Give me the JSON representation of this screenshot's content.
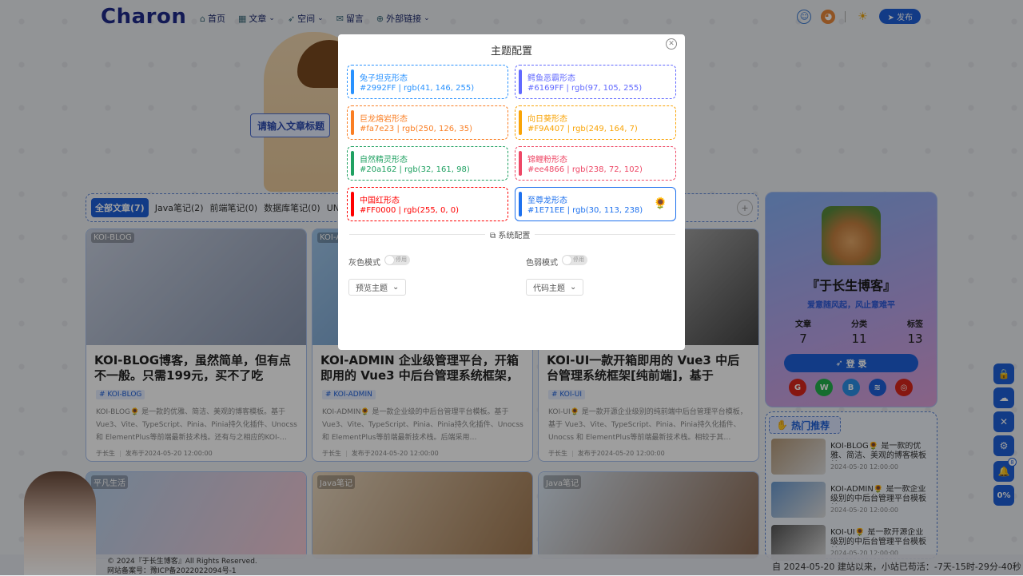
{
  "header": {
    "logo": "Charon",
    "nav": [
      {
        "icon": "home-icon",
        "glyph": "⌂",
        "label": "首页",
        "chevron": false
      },
      {
        "icon": "grid-icon",
        "glyph": "▦",
        "label": "文章",
        "chevron": true
      },
      {
        "icon": "rocket-icon",
        "glyph": "➶",
        "label": "空间",
        "chevron": true
      },
      {
        "icon": "message-icon",
        "glyph": "✉",
        "label": "留言",
        "chevron": false
      },
      {
        "icon": "link-icon",
        "glyph": "⊕",
        "label": "外部链接",
        "chevron": true
      }
    ],
    "publish": "发布"
  },
  "hero": {
    "search_label": "请输入文章标题"
  },
  "tabs": {
    "items": [
      "全部文章(7)",
      "Java笔记(2)",
      "前端笔记(0)",
      "数据库笔记(0)",
      "UN"
    ],
    "plus": "+"
  },
  "cards": [
    {
      "badge": "KOI-BLOG",
      "title": "KOI-BLOG博客，虽然简单，但有点不一般。只需199元，买不了吃亏，…",
      "tag": "# KOI-BLOG",
      "desc": "KOI-BLOG🌻 是一款的优雅、简洁、美观的博客模板。基于 Vue3、Vite、TypeScript、Pinia、Pinia持久化插件、Unocss 和 ElementPlus等前端最新技术栈。还有与之相应的KOI-…",
      "author": "于长生",
      "date": "发布于2024-05-20 12:00:00",
      "color1": "#c8d0e0",
      "color2": "#8a97b0"
    },
    {
      "badge": "KOI-ADMIN",
      "title": "KOI-ADMIN 企业级管理平台，开箱即用的 Vue3 中后台管理系统框架，从…",
      "tag": "# KOI-ADMIN",
      "desc": "KOI-ADMIN🌻 是一款企业级的中后台管理平台模板。基于 Vue3、Vite、TypeScript、Pinia、Pinia持久化插件、Unocss 和 ElementPlus等前端最新技术栈。后端采用…",
      "author": "于长生",
      "date": "发布于2024-05-20 12:00:00",
      "color1": "#9fc6ea",
      "color2": "#5a86b8"
    },
    {
      "badge": "KOI-UI",
      "title": "KOI-UI一款开箱即用的 Vue3 中后台管理系统框架[纯前端]，基于 Vue3…",
      "tag": "# KOI-UI",
      "desc": "KOI-UI🌻 是一款开源企业级别的纯前端中后台管理平台模板，基于 Vue3、Vite、TypeScript、Pinia、Pinia持久化插件、Unocss 和 ElementPlus等前端最新技术栈。相较于其…",
      "author": "于长生",
      "date": "发布于2024-05-20 12:00:00",
      "color1": "#e6e6e6",
      "color2": "#444444"
    }
  ],
  "cards_bottom": [
    {
      "badge": "平凡生活",
      "color1": "#b7d2ec",
      "color2": "#f4c7d3"
    },
    {
      "badge": "Java笔记",
      "color1": "#e8d7bf",
      "color2": "#a07850"
    },
    {
      "badge": "Java笔记",
      "color1": "#dbe8f5",
      "color2": "#8a6850"
    }
  ],
  "profile": {
    "name": "『于长生博客』",
    "slogan": "爱意随风起，风止意难平",
    "stats": [
      {
        "label": "文章",
        "value": "7"
      },
      {
        "label": "分类",
        "value": "11"
      },
      {
        "label": "标签",
        "value": "13"
      }
    ],
    "login": "登 录",
    "socials": [
      {
        "name": "gitee-icon",
        "glyph": "G",
        "color": "#d9261c"
      },
      {
        "name": "wechat-icon",
        "glyph": "W",
        "color": "#22b14c"
      },
      {
        "name": "bilibili-icon",
        "glyph": "B",
        "color": "#2b8fe6"
      },
      {
        "name": "layers-icon",
        "glyph": "≋",
        "color": "#1e5fd9"
      },
      {
        "name": "target-icon",
        "glyph": "◎",
        "color": "#d9261c"
      }
    ]
  },
  "hot": {
    "title": "热门推荐",
    "items": [
      {
        "title": "KOI-BLOG🌻 是一款的优雅、简洁、美观的博客模板基于…",
        "date": "2024-05-20 12:00:00",
        "color": "#b59a7a"
      },
      {
        "title": "KOI-ADMIN🌻 是一款企业级别的中后台管理平台模板基于…",
        "date": "2024-05-20 12:00:00",
        "color": "#6a9ad0"
      },
      {
        "title": "KOI-UI🌻 是一款开源企业级别的中后台管理平台模板基于…",
        "date": "2024-05-20 12:00:00",
        "color": "#555555"
      }
    ]
  },
  "float_buttons": [
    {
      "name": "lock-icon",
      "glyph": "🔒"
    },
    {
      "name": "cloud-icon",
      "glyph": "☁"
    },
    {
      "name": "close-icon",
      "glyph": "✕"
    },
    {
      "name": "gear-icon",
      "glyph": "⚙"
    },
    {
      "name": "bell-icon",
      "glyph": "🔔",
      "count": "8"
    },
    {
      "name": "progress-indicator",
      "glyph": "0%"
    }
  ],
  "footer": {
    "copyright": "© 2024『于长生博客』All Rights Reserved.",
    "icp": "网站备案号：豫ICP备2022022094号-1",
    "runtime": "自 2024-05-20 建站以来，小站已苟活：-7天-15时-29分-40秒"
  },
  "modal": {
    "title": "主题配置",
    "themes": [
      {
        "name": "兔子坦克形态",
        "code": "#2992FF | rgb(41, 146, 255)",
        "color": "#2992FF",
        "active": false
      },
      {
        "name": "鳄鱼恶霸形态",
        "code": "#6169FF | rgb(97, 105, 255)",
        "color": "#6169FF",
        "active": false
      },
      {
        "name": "巨龙熔岩形态",
        "code": "#fa7e23 | rgb(250, 126, 35)",
        "color": "#fa7e23",
        "active": false
      },
      {
        "name": "向日葵形态",
        "code": "#F9A407 | rgb(249, 164, 7)",
        "color": "#F9A407",
        "active": false
      },
      {
        "name": "自然精灵形态",
        "code": "#20a162 | rgb(32, 161, 98)",
        "color": "#20a162",
        "active": false
      },
      {
        "name": "锦鲤粉形态",
        "code": "#ee4866 | rgb(238, 72, 102)",
        "color": "#ee4866",
        "active": false
      },
      {
        "name": "中国红形态",
        "code": "#FF0000 | rgb(255, 0, 0)",
        "color": "#FF0000",
        "active": false
      },
      {
        "name": "至尊龙形态",
        "code": "#1E71EE | rgb(30, 113, 238)",
        "color": "#1E71EE",
        "active": true
      }
    ],
    "system_label": "系统配置",
    "gray_mode": "灰色模式",
    "weak_mode": "色弱模式",
    "toggle_text": "停用",
    "preview_theme": "预览主题",
    "code_theme": "代码主题"
  }
}
